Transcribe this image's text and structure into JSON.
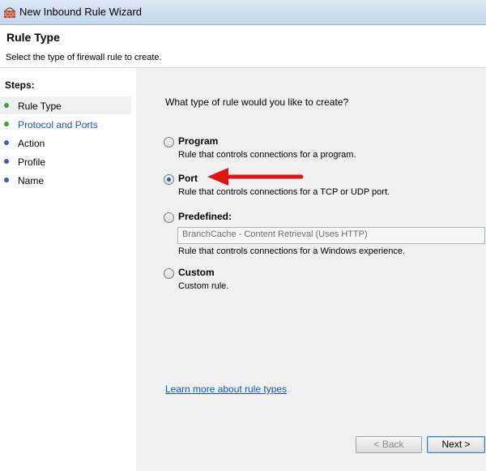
{
  "window": {
    "title": "New Inbound Rule Wizard"
  },
  "header": {
    "heading": "Rule Type",
    "description": "Select the type of firewall rule to create."
  },
  "steps": {
    "title": "Steps:",
    "items": [
      {
        "label": "Rule Type",
        "color": "#3aa13a",
        "label_color": "#000000"
      },
      {
        "label": "Protocol and Ports",
        "color": "#3aa13a",
        "label_color": "#1a56b3"
      },
      {
        "label": "Action",
        "color": "#4858b0",
        "label_color": "#000000"
      },
      {
        "label": "Profile",
        "color": "#4858b0",
        "label_color": "#000000"
      },
      {
        "label": "Name",
        "color": "#4858b0",
        "label_color": "#000000"
      }
    ]
  },
  "content": {
    "question": "What type of rule would you like to create?",
    "options": [
      {
        "label": "Program",
        "description": "Rule that controls connections for a program.",
        "checked": false
      },
      {
        "label": "Port",
        "description": "Rule that controls connections for a TCP or UDP port.",
        "checked": true
      },
      {
        "label": "Predefined:",
        "description": "Rule that controls connections for a Windows experience.",
        "checked": false
      },
      {
        "label": "Custom",
        "description": "Custom rule.",
        "checked": false
      }
    ],
    "predefined_combo": "BranchCache - Content Retrieval (Uses HTTP)",
    "learn_more": "Learn more about rule types"
  },
  "buttons": {
    "back": "< Back",
    "next": "Next >"
  },
  "colors": {
    "arrow": "#e01414",
    "link": "#0d55b2"
  }
}
